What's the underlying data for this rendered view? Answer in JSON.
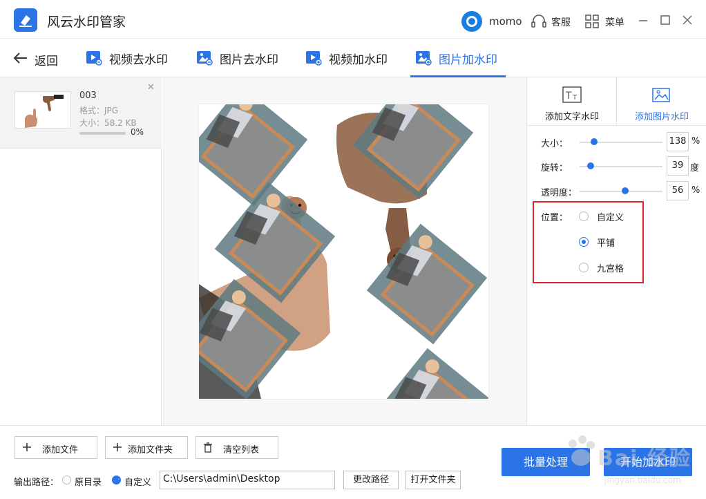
{
  "app": {
    "title": "风云水印管家"
  },
  "user": {
    "name": "momo"
  },
  "titlebar": {
    "service_label": "客服",
    "menu_label": "菜单"
  },
  "nav": {
    "back_label": "返回",
    "tabs": [
      {
        "label": "视频去水印"
      },
      {
        "label": "图片去水印"
      },
      {
        "label": "视频加水印"
      },
      {
        "label": "图片加水印",
        "active": true
      }
    ]
  },
  "files": [
    {
      "name": "003",
      "format": "格式：JPG",
      "size": "大小：58.2 KB",
      "progress": "0%"
    }
  ],
  "watermark_tabs": [
    {
      "label": "添加文字水印"
    },
    {
      "label": "添加图片水印",
      "active": true
    }
  ],
  "settings": {
    "size": {
      "label": "大小：",
      "value": "138",
      "unit": "%"
    },
    "rotate": {
      "label": "旋转：",
      "value": "39",
      "unit": "度"
    },
    "opacity": {
      "label": "透明度：",
      "value": "56",
      "unit": "%"
    }
  },
  "position": {
    "label": "位置：",
    "options": [
      {
        "label": "自定义",
        "checked": false
      },
      {
        "label": "平铺",
        "checked": true
      },
      {
        "label": "九宫格",
        "checked": false
      }
    ]
  },
  "footer": {
    "add_file": "添加文件",
    "add_folder": "添加文件夹",
    "clear_list": "清空列表",
    "output_label": "输出路径：",
    "opt_original": "原目录",
    "opt_custom": "自定义",
    "path": "C:\\Users\\admin\\Desktop",
    "change_path": "更改路径",
    "open_folder": "打开文件夹",
    "batch": "批量处理",
    "start": "开始加水印"
  },
  "overlay_watermark": {
    "brand": "Bai 经验",
    "url": "jingyan.baidu.com"
  },
  "colors": {
    "accent": "#2b74e8",
    "highlight_box": "#e0242c"
  }
}
